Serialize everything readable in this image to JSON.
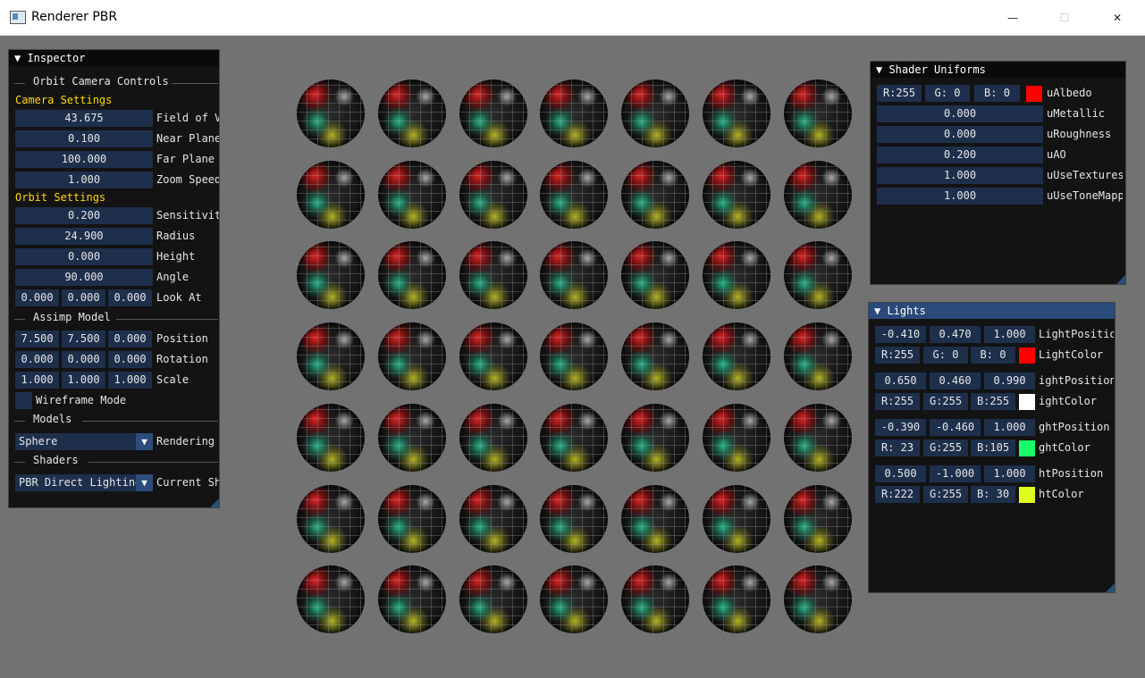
{
  "window": {
    "title": "Renderer PBR",
    "minimize_glyph": "—",
    "maximize_glyph": "☐",
    "close_glyph": "✕"
  },
  "inspector": {
    "title": "▼ Inspector",
    "orbit_header": "Orbit Camera Controls",
    "camera_settings_label": "Camera Settings",
    "camera": [
      {
        "value": "43.675",
        "label": "Field of View"
      },
      {
        "value": "0.100",
        "label": "Near Plane"
      },
      {
        "value": "100.000",
        "label": "Far Plane"
      },
      {
        "value": "1.000",
        "label": "Zoom Speed"
      }
    ],
    "orbit_settings_label": "Orbit Settings",
    "orbit": [
      {
        "value": "0.200",
        "label": "Sensitivity"
      },
      {
        "value": "24.900",
        "label": "Radius"
      },
      {
        "value": "0.000",
        "label": "Height"
      },
      {
        "value": "90.000",
        "label": "Angle"
      }
    ],
    "look_at": {
      "x": "0.000",
      "y": "0.000",
      "z": "0.000",
      "label": "Look At"
    },
    "assimp_header": "Assimp Model",
    "position": {
      "x": "7.500",
      "y": "7.500",
      "z": "0.000",
      "label": "Position"
    },
    "rotation": {
      "x": "0.000",
      "y": "0.000",
      "z": "0.000",
      "label": "Rotation"
    },
    "scale": {
      "x": "1.000",
      "y": "1.000",
      "z": "1.000",
      "label": "Scale"
    },
    "wireframe_label": "Wireframe Mode",
    "models_header": "Models",
    "model_select": "Sphere",
    "model_select_label": "Rendering",
    "shaders_header": "Shaders",
    "shader_select": "PBR Direct Lighting",
    "shader_select_label": "Current Shader"
  },
  "shader_uniforms": {
    "title": "▼ Shader Uniforms",
    "albedo": {
      "r": "R:255",
      "g": "G:  0",
      "b": "B:  0",
      "color": "#ff0000",
      "label": "uAlbedo"
    },
    "uniforms": [
      {
        "value": "0.000",
        "label": "uMetallic"
      },
      {
        "value": "0.000",
        "label": "uRoughness"
      },
      {
        "value": "0.200",
        "label": "uAO"
      },
      {
        "value": "1.000",
        "label": "uUseTextures"
      },
      {
        "value": "1.000",
        "label": "uUseToneMapping"
      }
    ]
  },
  "lights": {
    "title": "▼ Lights",
    "items": [
      {
        "px": "-0.410",
        "py": "0.470",
        "pz": "1.000",
        "pos_label": "LightPosition",
        "r": "R:255",
        "g": "G:  0",
        "b": "B:  0",
        "color": "#ff0000",
        "color_label": "LightColor"
      },
      {
        "px": "0.650",
        "py": "0.460",
        "pz": "0.990",
        "pos_label": "ightPosition",
        "r": "R:255",
        "g": "G:255",
        "b": "B:255",
        "color": "#ffffff",
        "color_label": "ightColor"
      },
      {
        "px": "-0.390",
        "py": "-0.460",
        "pz": "1.000",
        "pos_label": "ghtPosition",
        "r": "R: 23",
        "g": "G:255",
        "b": "B:105",
        "color": "#17ff69",
        "color_label": "ghtColor"
      },
      {
        "px": "0.500",
        "py": "-1.000",
        "pz": "1.000",
        "pos_label": "htPosition",
        "r": "R:222",
        "g": "G:255",
        "b": "B: 30",
        "color": "#deff1e",
        "color_label": "htColor"
      }
    ]
  },
  "scene": {
    "rows": 7,
    "cols": 7,
    "object": "sphere"
  }
}
